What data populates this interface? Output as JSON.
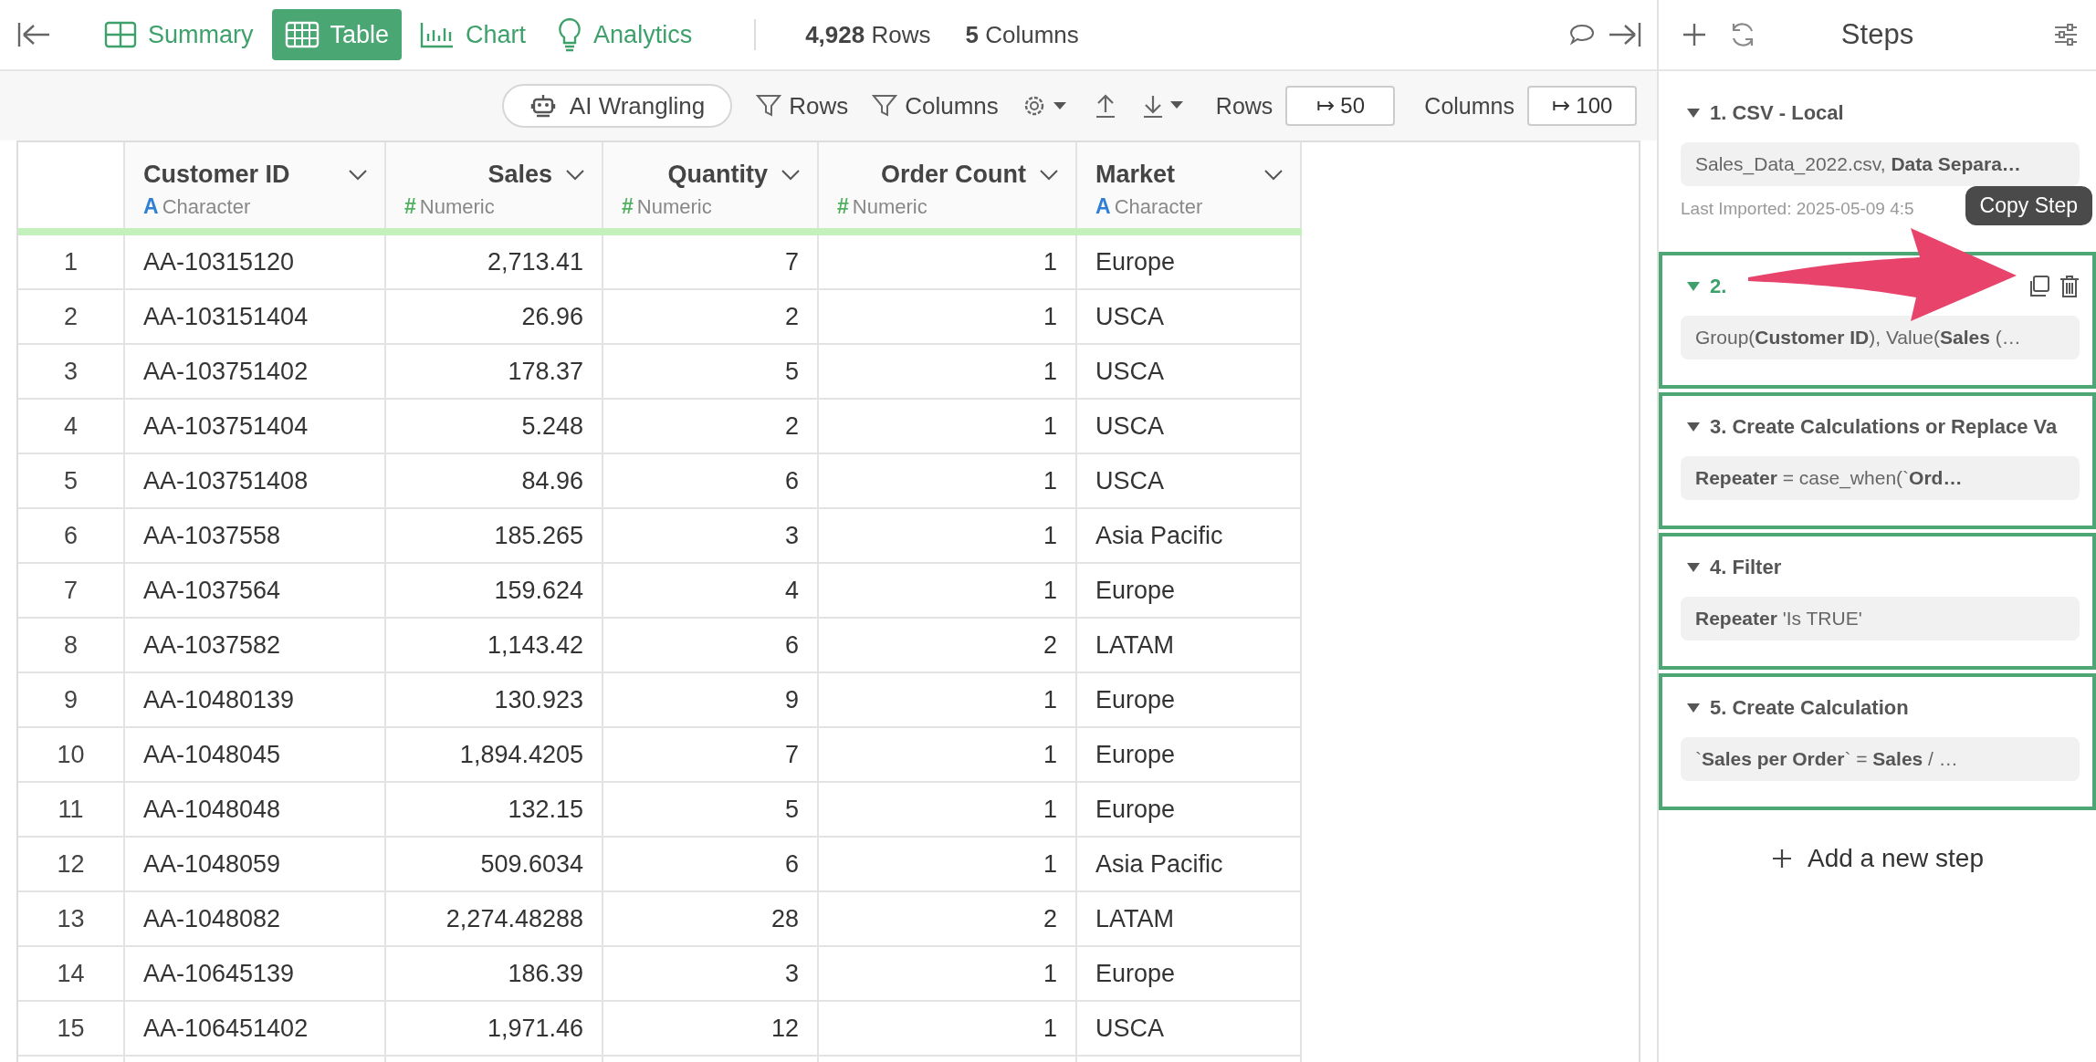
{
  "tabs": [
    {
      "label": "Summary",
      "selected": false
    },
    {
      "label": "Table",
      "selected": true
    },
    {
      "label": "Chart",
      "selected": false
    },
    {
      "label": "Analytics",
      "selected": false
    }
  ],
  "counts": [
    "**4,928** Rows",
    "**5** Columns"
  ],
  "toolbar": {
    "ai_button": "AI Wrangling",
    "rows_filter": "Rows",
    "columns_filter": "Columns",
    "rows_label": "Rows",
    "rows_value": "↦ 50",
    "columns_label": "Columns",
    "columns_value": "↦ 100"
  },
  "table": {
    "columns": [
      {
        "name": "Customer ID",
        "type_icon": "A",
        "type": "Character",
        "kind": "character"
      },
      {
        "name": "Sales",
        "type_icon": "#",
        "type": "Numeric",
        "kind": "numeric"
      },
      {
        "name": "Quantity",
        "type_icon": "#",
        "type": "Numeric",
        "kind": "numeric"
      },
      {
        "name": "Order Count",
        "type_icon": "#",
        "type": "Numeric",
        "kind": "numeric"
      },
      {
        "name": "Market",
        "type_icon": "A",
        "type": "Character",
        "kind": "character"
      }
    ],
    "rows": [
      {
        "row_number": "1",
        "cells": [
          "AA-10315120",
          "2,713.41",
          "7",
          "1",
          "Europe"
        ]
      },
      {
        "row_number": "2",
        "cells": [
          "AA-103151404",
          "26.96",
          "2",
          "1",
          "USCA"
        ]
      },
      {
        "row_number": "3",
        "cells": [
          "AA-103751402",
          "178.37",
          "5",
          "1",
          "USCA"
        ]
      },
      {
        "row_number": "4",
        "cells": [
          "AA-103751404",
          "5.248",
          "2",
          "1",
          "USCA"
        ]
      },
      {
        "row_number": "5",
        "cells": [
          "AA-103751408",
          "84.96",
          "6",
          "1",
          "USCA"
        ]
      },
      {
        "row_number": "6",
        "cells": [
          "AA-1037558",
          "185.265",
          "3",
          "1",
          "Asia Pacific"
        ]
      },
      {
        "row_number": "7",
        "cells": [
          "AA-1037564",
          "159.624",
          "4",
          "1",
          "Europe"
        ]
      },
      {
        "row_number": "8",
        "cells": [
          "AA-1037582",
          "1,143.42",
          "6",
          "2",
          "LATAM"
        ]
      },
      {
        "row_number": "9",
        "cells": [
          "AA-10480139",
          "130.923",
          "9",
          "1",
          "Europe"
        ]
      },
      {
        "row_number": "10",
        "cells": [
          "AA-1048045",
          "1,894.4205",
          "7",
          "1",
          "Europe"
        ]
      },
      {
        "row_number": "11",
        "cells": [
          "AA-1048048",
          "132.15",
          "5",
          "1",
          "Europe"
        ]
      },
      {
        "row_number": "12",
        "cells": [
          "AA-1048059",
          "509.6034",
          "6",
          "1",
          "Asia Pacific"
        ]
      },
      {
        "row_number": "13",
        "cells": [
          "AA-1048082",
          "2,274.48288",
          "28",
          "2",
          "LATAM"
        ]
      },
      {
        "row_number": "14",
        "cells": [
          "AA-10645139",
          "186.39",
          "3",
          "1",
          "Europe"
        ]
      },
      {
        "row_number": "15",
        "cells": [
          "AA-106451402",
          "1,971.46",
          "12",
          "1",
          "USCA"
        ]
      }
    ]
  },
  "steps_panel": {
    "title": "Steps",
    "add_step": "Add a new step",
    "tooltip": "Copy Step",
    "steps": [
      {
        "title": "1. CSV - Local",
        "summary": "Sales_Data_2022.csv, **Data Separa…**",
        "note": "Last Imported: 2025-05-09 4:5",
        "selected": false,
        "outlined": false
      },
      {
        "title": "2.",
        "summary": "Group(**Customer ID**), Value(**Sales** (…",
        "selected": true,
        "outlined": true
      },
      {
        "title": "3. Create Calculations or Replace Va",
        "summary": "**Repeater** = case_when(`**Ord…**",
        "selected": false,
        "outlined": true
      },
      {
        "title": "4. Filter",
        "summary": "**Repeater** 'Is TRUE'",
        "selected": false,
        "outlined": true
      },
      {
        "title": "5. Create Calculation",
        "summary": "`**Sales per Order**` = **Sales** / …",
        "selected": false,
        "outlined": true
      }
    ]
  }
}
